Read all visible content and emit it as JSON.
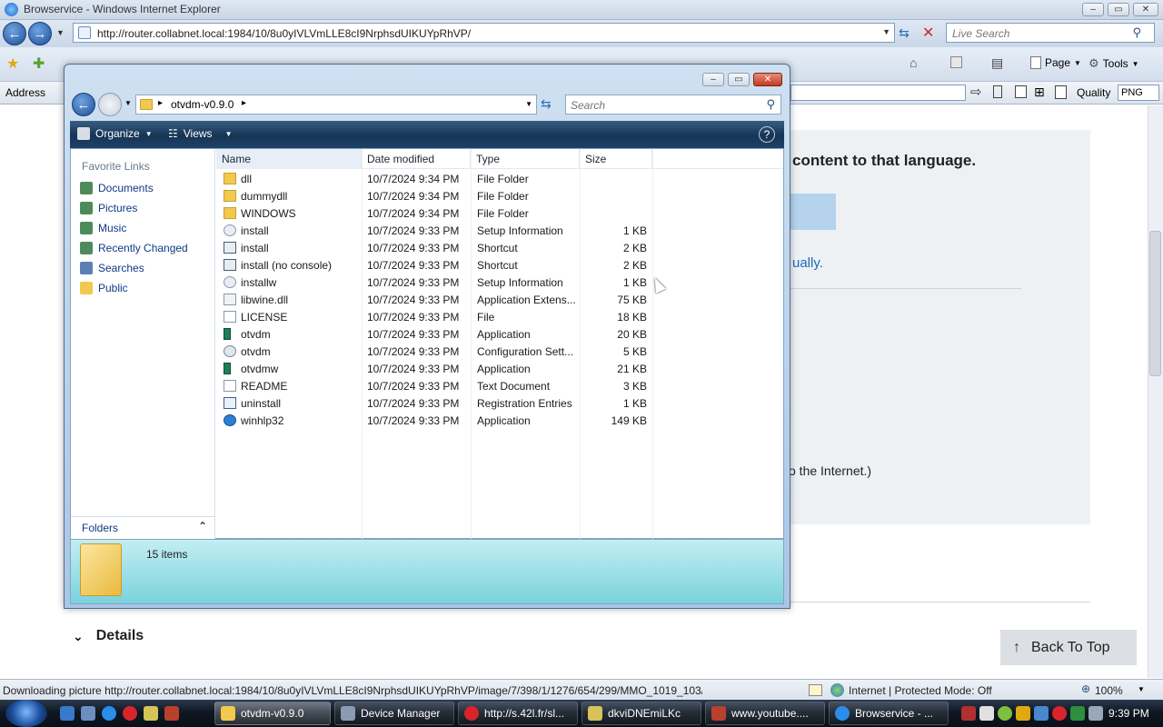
{
  "ie": {
    "window_title": "Browservice - Windows Internet Explorer",
    "url": "http://router.collabnet.local:1984/10/8u0yIVLVmLLE8cI9NrphsdUIKUYpRhVP/",
    "live_search_placeholder": "Live Search",
    "page_menu": "Page",
    "tools_menu": "Tools",
    "address_label": "Address",
    "quality_label": "Quality",
    "quality_value": "PNG"
  },
  "page": {
    "heading_fragment": "content to that language.",
    "link_fragment": "ually.",
    "text_fragment": "o the Internet.)",
    "details_label": "Details",
    "back_to_top": "Back To Top"
  },
  "explorer": {
    "path_folder": "otvdm-v0.9.0",
    "search_placeholder": "Search",
    "toolbar": {
      "organize": "Organize",
      "views": "Views"
    },
    "favorite_links_title": "Favorite Links",
    "favorite_links": [
      "Documents",
      "Pictures",
      "Music",
      "Recently Changed",
      "Searches",
      "Public"
    ],
    "folders_label": "Folders",
    "columns": [
      "Name",
      "Date modified",
      "Type",
      "Size"
    ],
    "files": [
      {
        "name": "dll",
        "date": "10/7/2024 9:34 PM",
        "type": "File Folder",
        "size": "",
        "icon": "folder-icon"
      },
      {
        "name": "dummydll",
        "date": "10/7/2024 9:34 PM",
        "type": "File Folder",
        "size": "",
        "icon": "folder-icon"
      },
      {
        "name": "WINDOWS",
        "date": "10/7/2024 9:34 PM",
        "type": "File Folder",
        "size": "",
        "icon": "folder-icon"
      },
      {
        "name": "install",
        "date": "10/7/2024 9:33 PM",
        "type": "Setup Information",
        "size": "1 KB",
        "icon": "setup-info-icon"
      },
      {
        "name": "install",
        "date": "10/7/2024 9:33 PM",
        "type": "Shortcut",
        "size": "2 KB",
        "icon": "shortcut-icon"
      },
      {
        "name": "install (no console)",
        "date": "10/7/2024 9:33 PM",
        "type": "Shortcut",
        "size": "2 KB",
        "icon": "shortcut-icon"
      },
      {
        "name": "installw",
        "date": "10/7/2024 9:33 PM",
        "type": "Setup Information",
        "size": "1 KB",
        "icon": "setup-info-icon"
      },
      {
        "name": "libwine.dll",
        "date": "10/7/2024 9:33 PM",
        "type": "Application Extens...",
        "size": "75 KB",
        "icon": "dll-icon"
      },
      {
        "name": "LICENSE",
        "date": "10/7/2024 9:33 PM",
        "type": "File",
        "size": "18 KB",
        "icon": "file-icon"
      },
      {
        "name": "otvdm",
        "date": "10/7/2024 9:33 PM",
        "type": "Application",
        "size": "20 KB",
        "icon": "application-icon"
      },
      {
        "name": "otvdm",
        "date": "10/7/2024 9:33 PM",
        "type": "Configuration Sett...",
        "size": "5 KB",
        "icon": "config-icon"
      },
      {
        "name": "otvdmw",
        "date": "10/7/2024 9:33 PM",
        "type": "Application",
        "size": "21 KB",
        "icon": "application-icon"
      },
      {
        "name": "README",
        "date": "10/7/2024 9:33 PM",
        "type": "Text Document",
        "size": "3 KB",
        "icon": "text-document-icon"
      },
      {
        "name": "uninstall",
        "date": "10/7/2024 9:33 PM",
        "type": "Registration Entries",
        "size": "1 KB",
        "icon": "registry-icon"
      },
      {
        "name": "winhlp32",
        "date": "10/7/2024 9:33 PM",
        "type": "Application",
        "size": "149 KB",
        "icon": "help-application-icon"
      }
    ],
    "item_count": "15 items"
  },
  "status_bar": {
    "text": "Downloading picture http://router.collabnet.local:1984/10/8u0yIVLVmLLE8cI9NrphsdUIKUYpRhVP/image/7/398/1/1276/654/299/MMO_1019_103/",
    "zone": "Internet | Protected Mode: Off",
    "zoom": "100%"
  },
  "taskbar": {
    "tasks": [
      "otvdm-v0.9.0",
      "Device Manager",
      "http://s.42l.fr/sl...",
      "dkviDNEmiLKc",
      "www.youtube....",
      "Browservice - ..."
    ],
    "clock": "9:39 PM"
  },
  "colors": {
    "link_blue": "#0e3a85",
    "folder_yellow": "#f1c94e",
    "accent_blue": "#1b4f9c",
    "details_teal": "#7ad2dd"
  }
}
